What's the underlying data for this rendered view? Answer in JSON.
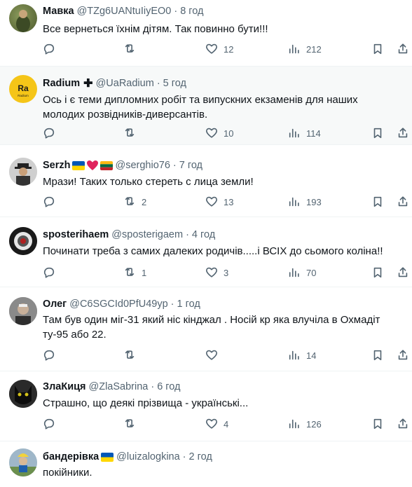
{
  "tweets": [
    {
      "name": "Мавка",
      "handle": "@TZg6UANtuIiyEO0",
      "time": "8 год",
      "text": "Все вернеться їхнім дітям. Так повинно бути!!!",
      "reply": "",
      "retweet": "",
      "like": "12",
      "views": "212"
    },
    {
      "name": "Radium",
      "handle": "@UaRadium",
      "time": "5 год",
      "text": "Ось і є теми дипломних робіт та випускних екзаменів для наших молодих розвідників-диверсантів.",
      "reply": "",
      "retweet": "",
      "like": "10",
      "views": "114",
      "avatar_text": "Ra",
      "avatar_sub": "Radium"
    },
    {
      "name": "Serzh",
      "handle": "@serghio76",
      "time": "7 год",
      "text": "Мрази! Таких только стереть с лица земли!",
      "reply": "",
      "retweet": "2",
      "like": "13",
      "views": "193"
    },
    {
      "name": "sposterihaem",
      "handle": "@sposterigaem",
      "time": "4 год",
      "text": "Починати треба з самих далеких родичів.....і ВСІХ до сьомого коліна!!",
      "reply": "",
      "retweet": "1",
      "like": "3",
      "views": "70"
    },
    {
      "name": "Олег",
      "handle": "@C6SGCId0PfU49yp",
      "time": "1 год",
      "text": "Там був один міг-31 який ніс кінджал . Носій кр яка влучіла в Охмадіт ту-95 або 22.",
      "reply": "",
      "retweet": "",
      "like": "",
      "views": "14"
    },
    {
      "name": "ЗлаКиця",
      "handle": "@ZlaSabrina",
      "time": "6 год",
      "text": "Страшно, що деякі прізвища - українські...",
      "reply": "",
      "retweet": "",
      "like": "4",
      "views": "126"
    },
    {
      "name": "бандерівка",
      "handle": "@luizalogkina",
      "time": "2 год",
      "text": "покійники.",
      "reply": "",
      "retweet": "",
      "like": "",
      "views": ""
    }
  ],
  "separator": "·",
  "colors": {
    "secondary": "#536471",
    "border": "#eff3f4",
    "highlight": "#f7f9f9",
    "ua_blue": "#0057b7",
    "ua_yellow": "#ffd700",
    "heart": "#e0245e"
  }
}
